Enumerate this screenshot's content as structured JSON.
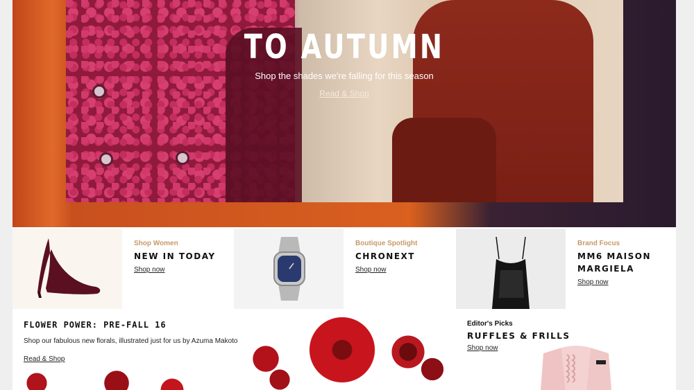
{
  "hero": {
    "title": "TO AUTUMN",
    "subtitle": "Shop the shades we're falling for this season",
    "link": "Read & Shop"
  },
  "tiles": [
    {
      "kicker": "Shop Women",
      "heading": "NEW IN TODAY",
      "link": "Shop now",
      "image": "burgundy-heel-shoe"
    },
    {
      "kicker": "Boutique Spotlight",
      "heading": "CHRONEXT",
      "link": "Shop now",
      "image": "silver-watch"
    },
    {
      "kicker": "Brand Focus",
      "heading": "MM6 MAISON MARGIELA",
      "link": "Shop now",
      "image": "black-slip-top"
    }
  ],
  "flower": {
    "title": "FLOWER POWER: PRE-FALL 16",
    "description": "Shop our fabulous new florals, illustrated just for us by Azuma Makoto",
    "link": "Read & Shop"
  },
  "editors": {
    "kicker": "Editor's Picks",
    "heading": "RUFFLES & FRILLS",
    "link": "Shop now",
    "image": "pink-ruffle-top"
  }
}
